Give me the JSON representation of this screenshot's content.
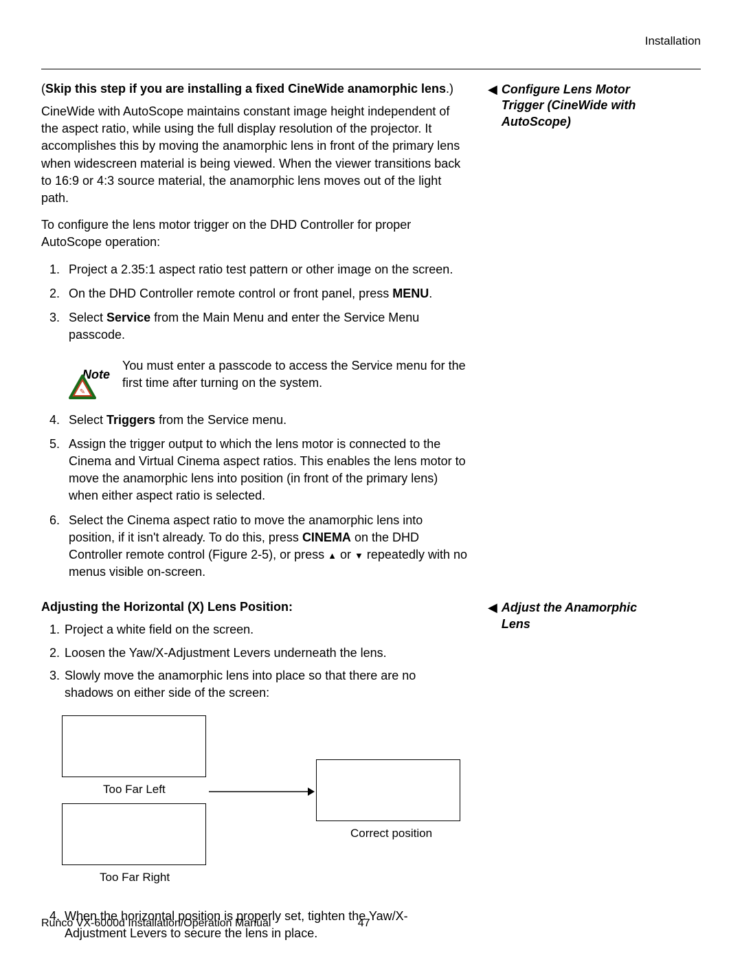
{
  "header": {
    "section": "Installation"
  },
  "side": {
    "note1": "Configure Lens Motor Trigger (CineWide with AutoScope)",
    "note2": "Adjust the Anamorphic Lens"
  },
  "skip_line": {
    "open": "(",
    "bold1": "Skip this step if you are installing a fixed CineWide anamorphic lens",
    "close": ".)"
  },
  "para1": "CineWide with AutoScope maintains constant image height independent of the aspect ratio, while using the full display resolution of the projector. It accomplishes this by moving the anamorphic lens in front of the primary lens when widescreen material is being viewed. When the viewer transitions back to 16:9 or 4:3 source material, the anamorphic lens moves out of the light path.",
  "para2": "To configure the lens motor trigger on the DHD Controller for proper AutoScope operation:",
  "list1": {
    "i1": "Project a 2.35:1 aspect ratio test pattern or other image on the screen.",
    "i2_a": "On the DHD Controller remote control or front panel, press ",
    "i2_b": "MENU",
    "i2_c": ".",
    "i3_a": "Select ",
    "i3_b": "Service",
    "i3_c": " from the Main Menu and enter the Service Menu passcode."
  },
  "note_box": {
    "label": "Note",
    "text": "You must enter a passcode to access the Service menu for the first time after turning on the system."
  },
  "list2": {
    "i4_a": "Select ",
    "i4_b": "Triggers",
    "i4_c": " from the Service menu.",
    "i5": "Assign the trigger output to which the lens motor is connected to the Cinema and Virtual Cinema aspect ratios. This enables the lens motor to move the anamorphic lens into position (in front of the primary lens) when either aspect ratio is selected.",
    "i6_a": "Select the Cinema aspect ratio to move the anamorphic lens into position, if it isn't already. To do this, press ",
    "i6_b": "CINEMA",
    "i6_c": " on the DHD Controller remote control (Figure 2-5), or press ",
    "i6_d": " or ",
    "i6_e": " repeatedly with no menus visible on-screen."
  },
  "subhead2": "Adjusting the Horizontal (X) Lens Position:",
  "list3": {
    "i1": "Project a white field on the screen.",
    "i2": "Loosen the Yaw/X-Adjustment Levers underneath the lens.",
    "i3": "Slowly move the anamorphic lens into place so that there are no shadows on either side of the screen:",
    "i4": "When the horizontal position is properly set, tighten the Yaw/X-Adjustment Levers to secure the lens in place."
  },
  "diagram": {
    "too_far_left": "Too Far Left",
    "too_far_right": "Too Far Right",
    "correct": "Correct position"
  },
  "footer": {
    "left": "Runco VX-6000d Installation/Operation Manual",
    "page": "47"
  }
}
